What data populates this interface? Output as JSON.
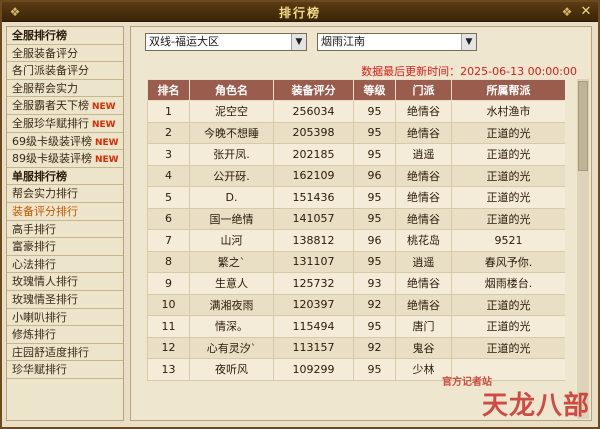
{
  "window": {
    "title": "排行榜",
    "close_glyph": "✕"
  },
  "sidebar": {
    "items": [
      {
        "label": "全服排行榜",
        "header": true,
        "new": false
      },
      {
        "label": "全服装备评分",
        "header": false,
        "new": false
      },
      {
        "label": "各门派装备评分",
        "header": false,
        "new": false
      },
      {
        "label": "全服帮会实力",
        "header": false,
        "new": false
      },
      {
        "label": "全服霸者天下榜",
        "header": false,
        "new": true
      },
      {
        "label": "全服珍华赋排行",
        "header": false,
        "new": true
      },
      {
        "label": "69级卡级装评榜",
        "header": false,
        "new": true
      },
      {
        "label": "89级卡级装评榜",
        "header": false,
        "new": true
      },
      {
        "label": "单服排行榜",
        "header": true,
        "new": false
      },
      {
        "label": "帮会实力排行",
        "header": false,
        "new": false
      },
      {
        "label": "装备评分排行",
        "header": false,
        "new": false,
        "active": true
      },
      {
        "label": "高手排行",
        "header": false,
        "new": false
      },
      {
        "label": "富豪排行",
        "header": false,
        "new": false
      },
      {
        "label": "心法排行",
        "header": false,
        "new": false
      },
      {
        "label": "玫瑰情人排行",
        "header": false,
        "new": false
      },
      {
        "label": "玫瑰情圣排行",
        "header": false,
        "new": false
      },
      {
        "label": "小喇叭排行",
        "header": false,
        "new": false
      },
      {
        "label": "修炼排行",
        "header": false,
        "new": false
      },
      {
        "label": "庄园舒适度排行",
        "header": false,
        "new": false
      },
      {
        "label": "珍华赋排行",
        "header": false,
        "new": false
      }
    ],
    "new_badge": "NEW"
  },
  "filters": {
    "server": "双线-福运大区",
    "world": "烟雨江南"
  },
  "updated_text": "数据最后更新时间：2025-06-13 00:00:00",
  "table": {
    "columns": [
      "排名",
      "角色名",
      "装备评分",
      "等级",
      "门派",
      "所属帮派"
    ],
    "rows": [
      [
        "1",
        "泥空空",
        "256034",
        "95",
        "绝情谷",
        "水村渔市"
      ],
      [
        "2",
        "今晚不想睡",
        "205398",
        "95",
        "绝情谷",
        "正道的光"
      ],
      [
        "3",
        "张开凤.",
        "202185",
        "95",
        "逍遥",
        "正道的光"
      ],
      [
        "4",
        "公开砑.",
        "162109",
        "96",
        "绝情谷",
        "正道的光"
      ],
      [
        "5",
        "D.",
        "151436",
        "95",
        "绝情谷",
        "正道的光"
      ],
      [
        "6",
        "国一绝情",
        "141057",
        "95",
        "绝情谷",
        "正道的光"
      ],
      [
        "7",
        "山河",
        "138812",
        "96",
        "桃花岛",
        "9521"
      ],
      [
        "8",
        "繁之`",
        "131107",
        "95",
        "逍遥",
        "春风予你."
      ],
      [
        "9",
        "生意人",
        "125732",
        "93",
        "绝情谷",
        "烟雨楼台."
      ],
      [
        "10",
        "满湘夜雨",
        "120397",
        "92",
        "绝情谷",
        "正道的光"
      ],
      [
        "11",
        "情深。",
        "115494",
        "95",
        "唐门",
        "正道的光"
      ],
      [
        "12",
        "心有灵汐`",
        "113157",
        "92",
        "鬼谷",
        "正道的光"
      ],
      [
        "13",
        "夜听风",
        "109299",
        "95",
        "少林",
        ""
      ]
    ]
  },
  "watermark": {
    "small": "官方记者站",
    "big": "天龙八部"
  },
  "colors": {
    "header_bg": "#9a5c4c",
    "update_red": "#d4201a",
    "active_orange": "#c25a00",
    "new_red": "#e02a00"
  }
}
